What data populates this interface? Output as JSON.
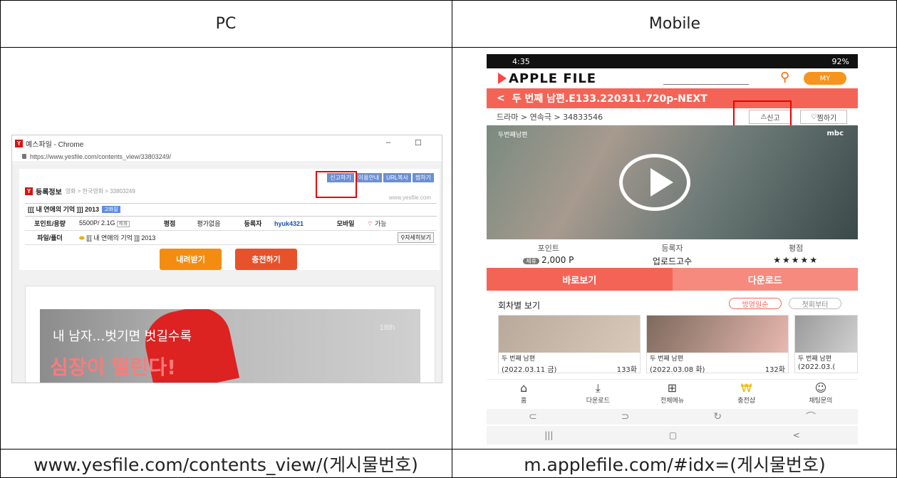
{
  "headers": {
    "pc": "PC",
    "mobile": "Mobile"
  },
  "footers": {
    "pc": "www.yesfile.com/contents_view/(게시물번호)",
    "mobile": "m.applefile.com/#idx=(게시물번호)"
  },
  "pc": {
    "window_title": "예스파일 - Chrome",
    "window_controls": [
      "–",
      "☐"
    ],
    "url": "https://www.yesfile.com/contents_view/33803249/",
    "action_buttons": [
      "신고하기",
      "이용안내",
      "URL복사",
      "찜하기"
    ],
    "reg_title": "등록정보",
    "breadcrumb": "영화 > 한국영화 > 33803249",
    "domain": "www.yesfile.com",
    "content_title": "[[[ 내 연애의 기억 ]]] 2013",
    "quality_badge": "고화질",
    "labels": {
      "point_size": "포인트/용량",
      "rating": "평점",
      "register": "등록자",
      "mobile": "모바일",
      "file_folder": "파일/폴더"
    },
    "values": {
      "point_size": "5500P/ 2.1G",
      "free_chip": "제휴",
      "rating": "평가없음",
      "register": "hyuk4321",
      "mobile": "가능",
      "file": "[[[ 내 연애의 기억 ]]] 2013",
      "detail": "자세히보기"
    },
    "download": "내려받기",
    "charge": "충전하기",
    "banner": {
      "line1": "내 남자…벗기면 벗길수록",
      "line2": "심장이 떨린다!",
      "line3": "18th"
    }
  },
  "mobile": {
    "status_time": "4:35",
    "status_battery": "92%",
    "logo": "APPLE FILE",
    "my_button": "MY",
    "title": "두 번째 남편.E133.220311.720p-NEXT",
    "breadcrumb": "드라마 > 연속극 > 34833546",
    "report": "신고",
    "favorite": "찜하기",
    "video_tag": "두번째남편",
    "video_logo": "mbc",
    "info": {
      "point_label": "포인트",
      "point_badge": "제휴",
      "point_value": "2,000 P",
      "register_label": "등록자",
      "register_value": "업로드고수",
      "rating_label": "평점",
      "rating_stars": "★★★★★"
    },
    "tabs": {
      "watch": "바로보기",
      "download": "다운로드"
    },
    "episodes_title": "회차별 보기",
    "order_air": "방영일순",
    "order_first": "첫회부터",
    "episodes": [
      {
        "name": "두 번째 남편",
        "date": "(2022.03.11 금)",
        "ep": "133화"
      },
      {
        "name": "두 번째 남편",
        "date": "(2022.03.08 화)",
        "ep": "132화"
      },
      {
        "name": "두 번째 남편",
        "date": "(2022.03.(",
        "ep": ""
      }
    ],
    "nav": [
      "홈",
      "다운로드",
      "전체메뉴",
      "충전샵",
      "채팅문의"
    ],
    "browser_buttons": [
      "⊂",
      "⊃",
      "↻",
      "⌒"
    ],
    "system_buttons": [
      "|||",
      "▢",
      "<"
    ]
  }
}
